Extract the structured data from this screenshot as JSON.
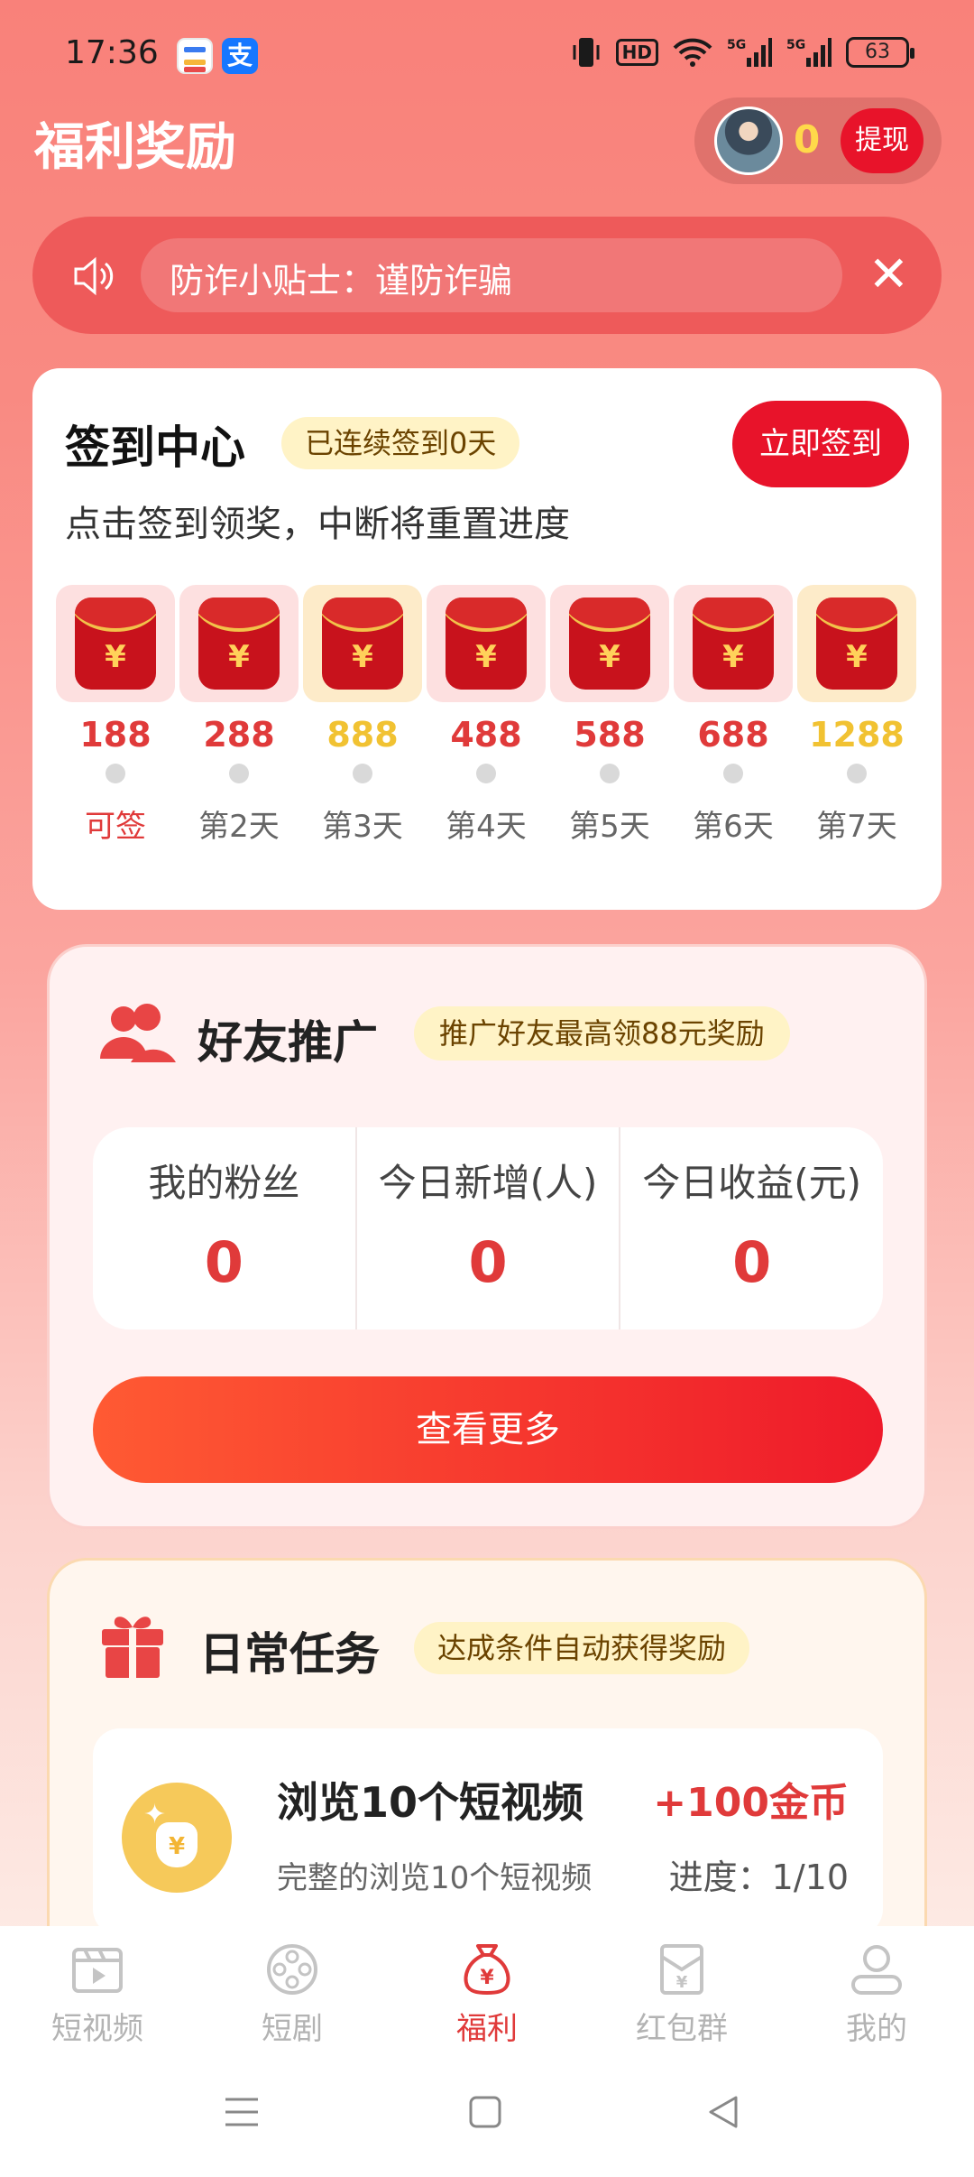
{
  "status_bar": {
    "time": "17:36",
    "battery": "63",
    "icons": [
      "vibrate-icon",
      "hd-icon",
      "wifi-icon",
      "signal-5g-icon",
      "signal-5g-icon"
    ]
  },
  "header": {
    "title": "福利奖励",
    "coins": "0",
    "withdraw_label": "提现"
  },
  "notice": {
    "text": "防诈小贴士：谨防诈骗"
  },
  "sign_in": {
    "title": "签到中心",
    "streak_badge": "已连续签到0天",
    "button_label": "立即签到",
    "subtitle": "点击签到领奖，中断将重置进度",
    "days": [
      {
        "value": "188",
        "label": "可签",
        "gold": false,
        "active": true
      },
      {
        "value": "288",
        "label": "第2天",
        "gold": false,
        "active": false
      },
      {
        "value": "888",
        "label": "第3天",
        "gold": true,
        "active": false
      },
      {
        "value": "488",
        "label": "第4天",
        "gold": false,
        "active": false
      },
      {
        "value": "588",
        "label": "第5天",
        "gold": false,
        "active": false
      },
      {
        "value": "688",
        "label": "第6天",
        "gold": false,
        "active": false
      },
      {
        "value": "1288",
        "label": "第7天",
        "gold": true,
        "active": false
      }
    ]
  },
  "friends": {
    "title": "好友推广",
    "badge": "推广好友最高领88元奖励",
    "stats": [
      {
        "label": "我的粉丝",
        "value": "0"
      },
      {
        "label": "今日新增(人)",
        "value": "0"
      },
      {
        "label": "今日收益(元)",
        "value": "0"
      }
    ],
    "more_label": "查看更多"
  },
  "tasks": {
    "title": "日常任务",
    "badge": "达成条件自动获得奖励",
    "items": [
      {
        "name": "浏览10个短视频",
        "reward": "+100金币",
        "desc": "完整的浏览10个短视频",
        "progress": "进度：1/10"
      }
    ]
  },
  "tabbar": {
    "items": [
      {
        "label": "短视频",
        "icon": "video-icon"
      },
      {
        "label": "短剧",
        "icon": "film-reel-icon"
      },
      {
        "label": "福利",
        "icon": "money-bag-icon"
      },
      {
        "label": "红包群",
        "icon": "red-envelope-icon"
      },
      {
        "label": "我的",
        "icon": "profile-icon"
      }
    ],
    "active_index": 2
  },
  "colors": {
    "accent": "#e8132a",
    "value_red": "#e03a3a",
    "gold": "#f1c232"
  }
}
